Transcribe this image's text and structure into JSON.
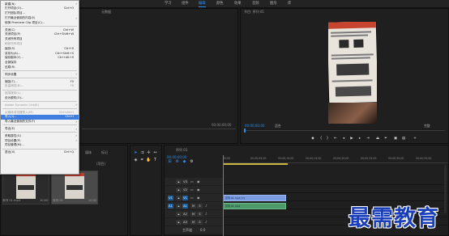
{
  "workspace_tabs": [
    "学习",
    "组件",
    "编辑",
    "颜色",
    "效果",
    "音频",
    "图形",
    "库"
  ],
  "source_panel": {
    "tab": "元数据",
    "timecode_right": "00;00;00;00"
  },
  "program_panel": {
    "title": "节目: 序列 01",
    "timecode": "00;00;00;00",
    "fit": "适合",
    "quality": "完整"
  },
  "project_panel": {
    "tabs": [
      "媒体",
      "标记"
    ],
    "search_hint": "(项目)",
    "items": [
      {
        "name": "序列 01.mp4",
        "duration": "10;00"
      },
      {
        "name": "序列 01",
        "duration": "10;00"
      }
    ]
  },
  "timeline": {
    "tab": "序列 01",
    "timecode": "00;00;00;00",
    "ruler": [
      "00;00",
      "00;00;05;00",
      "00;00;10;00",
      "00;00;15;00",
      "00;00;20;00",
      "00;00;25;00",
      "00;00;30;00",
      "00;00;35;00"
    ],
    "tracks": [
      {
        "id": "V3",
        "kind": "video"
      },
      {
        "id": "V2",
        "kind": "video"
      },
      {
        "id": "V1",
        "kind": "video",
        "clip": "序列 01.mp4 [V]"
      },
      {
        "id": "A1",
        "kind": "audio",
        "clip": "序列 01.mp4"
      },
      {
        "id": "A2",
        "kind": "audio"
      },
      {
        "id": "A3",
        "kind": "audio"
      }
    ],
    "master": "主声道",
    "master_value": "0.0"
  },
  "menu": {
    "items": [
      {
        "label": "新建(N)",
        "submenu": true
      },
      {
        "label": "打开项目(O)...",
        "shortcut": "Ctrl+O"
      },
      {
        "label": "打开团队项目...",
        "shortcut": ""
      },
      {
        "label": "打开最近使用的内容(E)",
        "submenu": true
      },
      {
        "label": "转换 Premiere Clip 项目(C)...",
        "shortcut": ""
      },
      {
        "sep": true
      },
      {
        "label": "关闭(C)",
        "shortcut": "Ctrl+W"
      },
      {
        "label": "关闭项目(P)",
        "shortcut": "Ctrl+Shift+W"
      },
      {
        "label": "关闭所有项目",
        "shortcut": ""
      },
      {
        "label": "刷新所有项目",
        "shortcut": "",
        "disabled": true
      },
      {
        "label": "保存(S)",
        "shortcut": "Ctrl+S"
      },
      {
        "label": "另存为(A)...",
        "shortcut": "Ctrl+Shift+S"
      },
      {
        "label": "保存副本(Y)...",
        "shortcut": "Ctrl+Alt+S"
      },
      {
        "label": "全部保存",
        "shortcut": ""
      },
      {
        "label": "还原(R)",
        "shortcut": ""
      },
      {
        "sep": true
      },
      {
        "label": "同步设置",
        "submenu": true
      },
      {
        "sep": true
      },
      {
        "label": "捕捉(T)...",
        "shortcut": "F5"
      },
      {
        "label": "批量捕捉(B)...",
        "shortcut": "F6",
        "disabled": true
      },
      {
        "sep": true
      },
      {
        "label": "链接媒体(L)...",
        "shortcut": "",
        "disabled": true
      },
      {
        "label": "设为脱机(O)...",
        "shortcut": ""
      },
      {
        "sep": true
      },
      {
        "label": "Adobe Dynamic Link(K)",
        "submenu": true,
        "disabled": true
      },
      {
        "sep": true
      },
      {
        "label": "从媒体浏览器导入(M)",
        "shortcut": "Ctrl+Alt+I",
        "disabled": true
      },
      {
        "label": "导入(I)...",
        "shortcut": "Ctrl+I",
        "highlight": true
      },
      {
        "label": "导入最近使用的文件(F)",
        "submenu": true
      },
      {
        "sep": true
      },
      {
        "label": "导出(E)",
        "submenu": true
      },
      {
        "sep": true
      },
      {
        "label": "获取属性(G)",
        "submenu": true
      },
      {
        "label": "项目设置(P)",
        "submenu": true
      },
      {
        "label": "项目管理(M)...",
        "shortcut": ""
      },
      {
        "sep": true
      },
      {
        "label": "退出(X)",
        "shortcut": "Ctrl+Q"
      }
    ]
  },
  "watermark": "最需教育",
  "colors": {
    "accent": "#2d8ceb",
    "menu_highlight": "#3d7ee0",
    "video_clip": "#7a9be0",
    "audio_clip": "#4f9a6b",
    "watermark": "#1a3fb8"
  }
}
